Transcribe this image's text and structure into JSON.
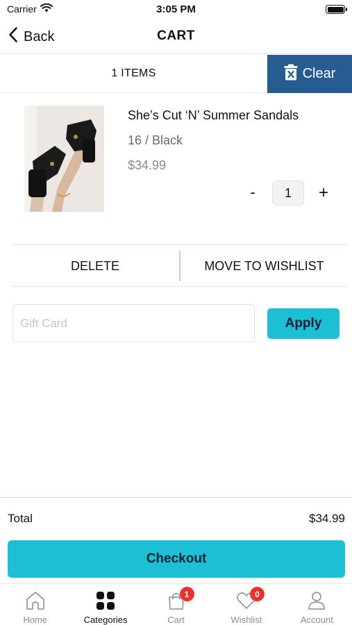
{
  "status_bar": {
    "carrier": "Carrier",
    "time": "3:05 PM"
  },
  "nav": {
    "back_label": "Back",
    "title": "CART"
  },
  "cart_bar": {
    "items_count": "1 ITEMS",
    "clear_label": "Clear"
  },
  "cart_item": {
    "name": "She’s Cut ‘N’ Summer Sandals",
    "variant": "16 / Black",
    "price": "$34.99",
    "quantity": "1",
    "qty_minus": "-",
    "qty_plus": "+"
  },
  "actions": {
    "delete_label": "DELETE",
    "wishlist_label": "MOVE TO WISHLIST"
  },
  "gift_card": {
    "placeholder": "Gift Card",
    "value": "",
    "apply_label": "Apply"
  },
  "summary": {
    "total_label": "Total",
    "total_value": "$34.99",
    "checkout_label": "Checkout"
  },
  "tabs": [
    {
      "label": "Home",
      "icon": "home-icon",
      "active": false,
      "badge": ""
    },
    {
      "label": "Categories",
      "icon": "grid-icon",
      "active": true,
      "badge": ""
    },
    {
      "label": "Cart",
      "icon": "shopping-bag-icon",
      "active": false,
      "badge": "1"
    },
    {
      "label": "Wishlist",
      "icon": "heart-icon",
      "active": false,
      "badge": "0"
    },
    {
      "label": "Account",
      "icon": "user-icon",
      "active": false,
      "badge": ""
    }
  ],
  "colors": {
    "accent": "#1cbfd3",
    "clear_button": "#265c8f",
    "badge": "#e8322b"
  }
}
